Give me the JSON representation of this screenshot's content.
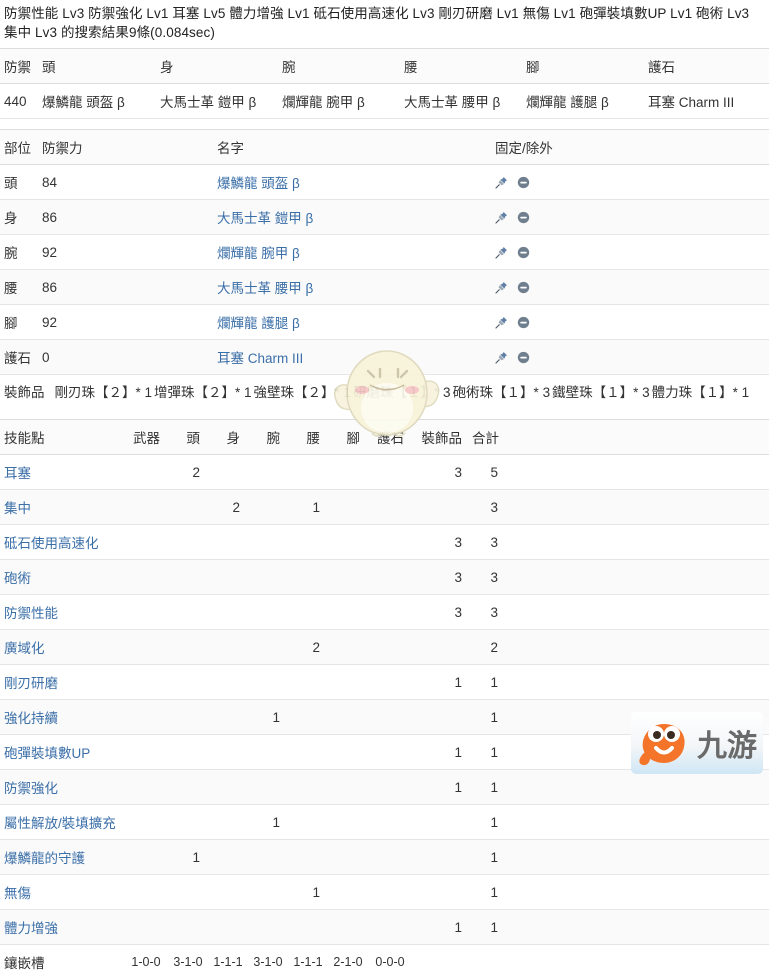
{
  "search": {
    "heading": "防禦性能 Lv3 防禦強化 Lv1 耳塞 Lv5 體力增強 Lv1 砥石使用高速化 Lv3 剛刃研磨 Lv1 無傷 Lv1 砲彈裝填數UP Lv1 砲術 Lv3 集中 Lv3 的搜索結果9條(0.084sec)"
  },
  "summary": {
    "headers": [
      "防禦",
      "頭",
      "身",
      "腕",
      "腰",
      "腳",
      "護石"
    ],
    "row": [
      "440",
      "爆鱗龍 頭盔 β",
      "大馬士革 鎧甲 β",
      "爛輝龍 腕甲 β",
      "大馬士革 腰甲 β",
      "爛輝龍 護腿 β",
      "耳塞 Charm III"
    ]
  },
  "armor": {
    "headers": [
      "部位",
      "防禦力",
      "名字",
      "固定/除外"
    ],
    "rows": [
      {
        "part": "頭",
        "defense": "84",
        "name": "爆鱗龍 頭盔 β"
      },
      {
        "part": "身",
        "defense": "86",
        "name": "大馬士革 鎧甲 β"
      },
      {
        "part": "腕",
        "defense": "92",
        "name": "爛輝龍 腕甲 β"
      },
      {
        "part": "腰",
        "defense": "86",
        "name": "大馬士革 腰甲 β"
      },
      {
        "part": "腳",
        "defense": "92",
        "name": "爛輝龍 護腿 β"
      },
      {
        "part": "護石",
        "defense": "0",
        "name": "耳塞 Charm III"
      }
    ],
    "icons": {
      "pin": "pushpin-icon",
      "exclude": "minus-circle-icon"
    }
  },
  "decorations": {
    "label": "裝飾品",
    "items": [
      "剛刃珠【２】* 1",
      "增彈珠【２】* 1",
      "強壁珠【２】* 1",
      "研磨珠【１】* 3",
      "砲術珠【１】* 3",
      "鐵壁珠【１】* 3",
      "體力珠【１】* 1"
    ]
  },
  "skills": {
    "headers": [
      "技能點",
      "武器",
      "頭",
      "身",
      "腕",
      "腰",
      "腳",
      "護石",
      "裝飾品",
      "合計"
    ],
    "rows": [
      {
        "name": "耳塞",
        "weapon": "",
        "head": "2",
        "body": "",
        "arms": "",
        "waist": "",
        "legs": "",
        "charm": "",
        "deco": "3",
        "total": "5"
      },
      {
        "name": "集中",
        "weapon": "",
        "head": "",
        "body": "2",
        "arms": "",
        "waist": "1",
        "legs": "",
        "charm": "",
        "deco": "",
        "total": "3"
      },
      {
        "name": "砥石使用高速化",
        "weapon": "",
        "head": "",
        "body": "",
        "arms": "",
        "waist": "",
        "legs": "",
        "charm": "",
        "deco": "3",
        "total": "3"
      },
      {
        "name": "砲術",
        "weapon": "",
        "head": "",
        "body": "",
        "arms": "",
        "waist": "",
        "legs": "",
        "charm": "",
        "deco": "3",
        "total": "3"
      },
      {
        "name": "防禦性能",
        "weapon": "",
        "head": "",
        "body": "",
        "arms": "",
        "waist": "",
        "legs": "",
        "charm": "",
        "deco": "3",
        "total": "3"
      },
      {
        "name": "廣域化",
        "weapon": "",
        "head": "",
        "body": "",
        "arms": "",
        "waist": "2",
        "legs": "",
        "charm": "",
        "deco": "",
        "total": "2"
      },
      {
        "name": "剛刃研磨",
        "weapon": "",
        "head": "",
        "body": "",
        "arms": "",
        "waist": "",
        "legs": "",
        "charm": "",
        "deco": "1",
        "total": "1"
      },
      {
        "name": "強化持續",
        "weapon": "",
        "head": "",
        "body": "",
        "arms": "1",
        "waist": "",
        "legs": "",
        "charm": "",
        "deco": "",
        "total": "1"
      },
      {
        "name": "砲彈裝填數UP",
        "weapon": "",
        "head": "",
        "body": "",
        "arms": "",
        "waist": "",
        "legs": "",
        "charm": "",
        "deco": "1",
        "total": "1"
      },
      {
        "name": "防禦強化",
        "weapon": "",
        "head": "",
        "body": "",
        "arms": "",
        "waist": "",
        "legs": "",
        "charm": "",
        "deco": "1",
        "total": "1"
      },
      {
        "name": "屬性解放/裝填擴充",
        "weapon": "",
        "head": "",
        "body": "",
        "arms": "1",
        "waist": "",
        "legs": "",
        "charm": "",
        "deco": "",
        "total": "1"
      },
      {
        "name": "爆鱗龍的守護",
        "weapon": "",
        "head": "1",
        "body": "",
        "arms": "",
        "waist": "",
        "legs": "",
        "charm": "",
        "deco": "",
        "total": "1"
      },
      {
        "name": "無傷",
        "weapon": "",
        "head": "",
        "body": "",
        "arms": "",
        "waist": "1",
        "legs": "",
        "charm": "",
        "deco": "",
        "total": "1"
      },
      {
        "name": "體力增強",
        "weapon": "",
        "head": "",
        "body": "",
        "arms": "",
        "waist": "",
        "legs": "",
        "charm": "",
        "deco": "1",
        "total": "1"
      }
    ],
    "slot_row": {
      "label": "鑲嵌槽",
      "values": [
        "1-0-0",
        "3-1-0",
        "1-1-1",
        "3-1-0",
        "1-1-1",
        "2-1-0",
        "0-0-0"
      ]
    }
  },
  "watermarks": {
    "brand_text": "九游",
    "brand_color": "#f4742a",
    "chick_name": "chick-mascot-watermark"
  },
  "colors": {
    "link": "#3b6fa8",
    "text": "#333333",
    "border": "#e0e0e0"
  }
}
